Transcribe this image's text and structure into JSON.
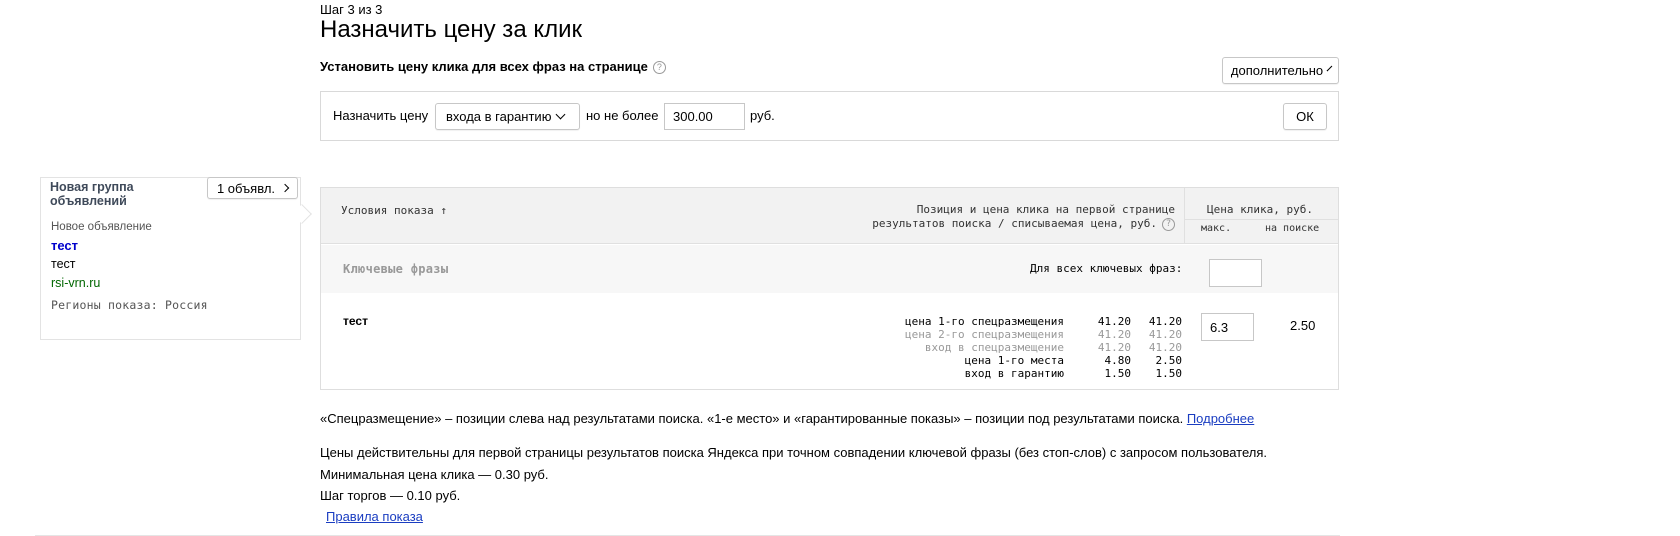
{
  "header": {
    "step": "Шаг 3 из 3",
    "title": "Назначить цену за клик"
  },
  "bulk": {
    "heading": "Установить цену клика для всех фраз на странице",
    "help_icon": "question-circle-icon",
    "advanced_button": "дополнительно",
    "assign_label": "Назначить цену",
    "strategy_selected": "входа в гарантию",
    "limit_label": "но не более",
    "limit_value": "300.00",
    "currency": "руб.",
    "ok_button": "ОК"
  },
  "ad": {
    "group_name": "Новая группа объявлений",
    "count_button": "1 объявл.",
    "label": "Новое объявление",
    "title": "тест",
    "text": "тест",
    "url": "rsi-vrn.ru",
    "regions": "Регионы показа: Россия"
  },
  "table": {
    "col_conditions": "Условия показа ↑",
    "col_position_line1": "Позиция и цена клика на первой странице",
    "col_position_line2": "результатов поиска / списываемая цена, руб.",
    "col_price": "Цена клика, руб.",
    "col_max": "макс.",
    "col_on_search": "на поиске",
    "keywords_heading": "Ключевые фразы",
    "all_keywords_label": "Для всех ключевых фраз:",
    "all_keywords_value": "",
    "rows": [
      {
        "phrase": "тест",
        "bids": [
          {
            "label": "цена 1-го спецразмещения",
            "price": "41.20",
            "charged": "41.20",
            "dim": false
          },
          {
            "label": "цена 2-го спецразмещения",
            "price": "41.20",
            "charged": "41.20",
            "dim": true
          },
          {
            "label": "вход в спецразмещение",
            "price": "41.20",
            "charged": "41.20",
            "dim": true
          },
          {
            "label": "цена 1-го места",
            "price": "4.80",
            "charged": "2.50",
            "dim": false
          },
          {
            "label": "вход в гарантию",
            "price": "1.50",
            "charged": "1.50",
            "dim": false
          }
        ],
        "max_price": "6.3",
        "search_price": "2.50"
      }
    ]
  },
  "notes": {
    "line1": "«Спецразмещение» – позиции слева над результатами поиска. «1-е место» и «гарантированные показы» – позиции под результатами поиска.",
    "line1_link": "Подробнее",
    "line2": "Цены действительны для первой страницы результатов поиска Яндекса при точном совпадении ключевой фразы (без стоп-слов) с запросом пользователя.",
    "line3": "Минимальная цена клика — 0.30 руб.",
    "line4": "Шаг торгов — 0.10 руб.",
    "rules_link": "Правила показа"
  },
  "colors": {
    "link": "#1a3dc1",
    "ad_title": "#0000cc",
    "ad_url": "#006600"
  }
}
